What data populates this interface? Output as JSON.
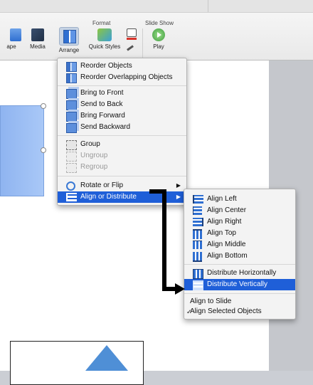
{
  "ribbon": {
    "groups": {
      "format": "Format",
      "slide_show": "Slide Show"
    },
    "buttons": {
      "shape": "ape",
      "media": "Media",
      "arrange": "Arrange",
      "quick_styles": "Quick Styles",
      "play": "Play"
    }
  },
  "arrange_menu": {
    "items": [
      {
        "label": "Reorder Objects",
        "icon": "reorder-icon"
      },
      {
        "label": "Reorder Overlapping Objects",
        "icon": "reorder-overlapping-icon"
      },
      {
        "label": "Bring to Front",
        "icon": "bring-to-front-icon"
      },
      {
        "label": "Send to Back",
        "icon": "send-to-back-icon"
      },
      {
        "label": "Bring Forward",
        "icon": "bring-forward-icon"
      },
      {
        "label": "Send Backward",
        "icon": "send-backward-icon"
      },
      {
        "label": "Group",
        "icon": "group-icon"
      },
      {
        "label": "Ungroup",
        "icon": "ungroup-icon",
        "disabled": true
      },
      {
        "label": "Regroup",
        "icon": "regroup-icon",
        "disabled": true
      },
      {
        "label": "Rotate or Flip",
        "icon": "rotate-icon",
        "submenu": true
      },
      {
        "label": "Align or Distribute",
        "icon": "align-icon",
        "submenu": true,
        "highlighted": true
      }
    ]
  },
  "align_menu": {
    "items": [
      {
        "label": "Align Left"
      },
      {
        "label": "Align Center"
      },
      {
        "label": "Align Right"
      },
      {
        "label": "Align Top"
      },
      {
        "label": "Align Middle"
      },
      {
        "label": "Align Bottom"
      },
      {
        "label": "Distribute Horizontally"
      },
      {
        "label": "Distribute Vertically",
        "highlighted": true
      },
      {
        "label": "Align to Slide"
      },
      {
        "label": "Align Selected Objects",
        "checked": true
      }
    ],
    "check_mark": "✓"
  },
  "submenu_arrow": "▶",
  "colors": {
    "highlight": "#1f5fd8",
    "accent_blue": "#4f8fd6"
  }
}
